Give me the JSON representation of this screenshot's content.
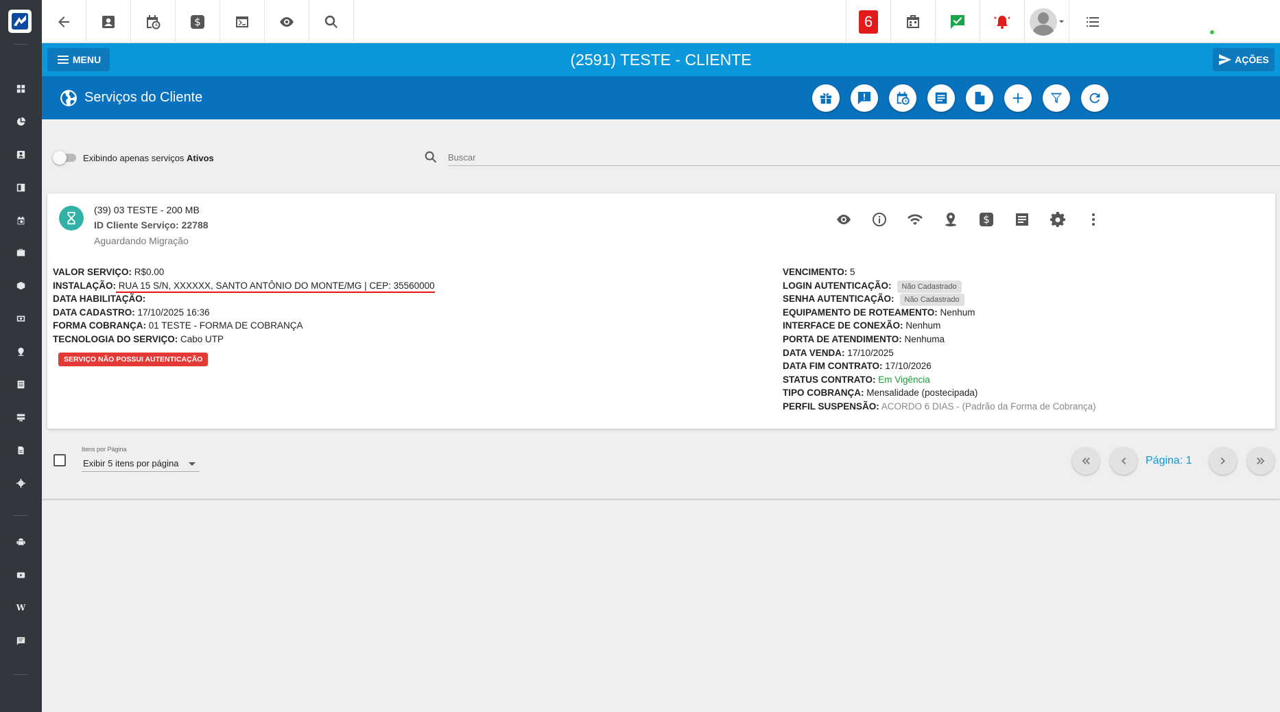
{
  "sidebar": {
    "logo_icon": "logo-icon",
    "items": [
      {
        "name": "dashboard-icon"
      },
      {
        "name": "chart-pie-icon"
      },
      {
        "name": "contacts-icon"
      },
      {
        "name": "board-icon"
      },
      {
        "name": "calendar-clock-icon"
      },
      {
        "name": "suitcase-icon"
      },
      {
        "name": "cube-icon"
      },
      {
        "name": "money-icon"
      },
      {
        "name": "map-pin-icon"
      },
      {
        "name": "list-icon"
      },
      {
        "name": "server-icon"
      },
      {
        "name": "document-icon"
      },
      {
        "name": "gear-icon"
      },
      {
        "name": "android-icon"
      },
      {
        "name": "youtube-icon"
      },
      {
        "name": "wiki-icon",
        "glyph": "W"
      },
      {
        "name": "chat-icon"
      }
    ]
  },
  "topbar": {
    "notification_count": "6",
    "buttons": [
      "back-icon",
      "contact-card-icon",
      "calendar-clock-icon",
      "dollar-icon",
      "terminal-icon",
      "eye-icon",
      "search-icon"
    ],
    "right_buttons": [
      "notification-count",
      "calendar-icon",
      "chat-check-icon",
      "alarm-icon",
      "avatar",
      "menu-list-icon"
    ]
  },
  "titlebar": {
    "menu_label": "MENU",
    "title": "(2591) TESTE - CLIENTE",
    "actions_label": "AÇÕES"
  },
  "section": {
    "title": "Serviços do Cliente",
    "buttons": [
      "gift-icon",
      "alert-message-icon",
      "calendar-clock-icon",
      "notes-icon",
      "file-icon",
      "plus-icon",
      "filter-icon",
      "refresh-icon"
    ]
  },
  "filter": {
    "toggle_label_prefix": "Exibindo apenas serviços ",
    "toggle_label_bold": "Ativos",
    "search_placeholder": "Buscar"
  },
  "service": {
    "name": "(39) 03 TESTE - 200 MB",
    "id_line": "ID Cliente Serviço: 22788",
    "status": "Aguardando Migração",
    "auth_badge": "SERVIÇO NÃO POSSUI AUTENTICAÇÃO",
    "left": {
      "valor_k": "VALOR SERVIÇO:",
      "valor_v": " R$0.00",
      "instalacao_k": "INSTALAÇÃO:",
      "instalacao_v": " RUA 15 S/N, XXXXXX, SANTO ANTÔNIO DO MONTE/MG | CEP: 35560000",
      "habilitacao_k": "DATA HABILITAÇÃO:",
      "habilitacao_v": "",
      "cadastro_k": "DATA CADASTRO:",
      "cadastro_v": " 17/10/2025 16:36",
      "forma_k": "FORMA COBRANÇA:",
      "forma_v": " 01 TESTE - FORMA DE COBRANÇA",
      "tecnologia_k": "TECNOLOGIA DO SERVIÇO:",
      "tecnologia_v": " Cabo UTP"
    },
    "right": {
      "vencimento_k": "VENCIMENTO:",
      "vencimento_v": " 5",
      "login_k": "LOGIN AUTENTICAÇÃO:",
      "login_tag": "Não Cadastrado",
      "senha_k": "SENHA AUTENTICAÇÃO:",
      "senha_tag": "Não Cadastrado",
      "equip_k": "EQUIPAMENTO DE ROTEAMENTO:",
      "equip_v": " Nenhum",
      "interface_k": "INTERFACE DE CONEXÃO:",
      "interface_v": " Nenhum",
      "porta_k": "PORTA DE ATENDIMENTO:",
      "porta_v": " Nenhuma",
      "venda_k": "DATA VENDA:",
      "venda_v": " 17/10/2025",
      "fim_k": "DATA FIM CONTRATO:",
      "fim_v": " 17/10/2026",
      "status_k": "STATUS CONTRATO:",
      "status_v": " Em Vigência",
      "tipo_k": "TIPO COBRANÇA:",
      "tipo_v": " Mensalidade (postecipada)",
      "perfil_k": "PERFIL SUSPENSÃO:",
      "perfil_v": " ACORDO 6 DIAS - (Padrão da Forma de Cobrança)"
    },
    "actions": [
      "eye-icon",
      "info-icon",
      "wifi-icon",
      "map-pin-icon",
      "dollar-icon",
      "notes-icon",
      "gear-icon",
      "more-vert-icon"
    ]
  },
  "footer": {
    "items_per_page_label": "Itens por Página",
    "items_per_page_value": "Exibir 5 itens por página",
    "page_label": "Página: 1"
  },
  "colors": {
    "titlebar": "#0a97dc",
    "section": "#0872be",
    "sidebar": "#32373d",
    "badge": "#e53935",
    "active_status": "#1d9b38"
  }
}
